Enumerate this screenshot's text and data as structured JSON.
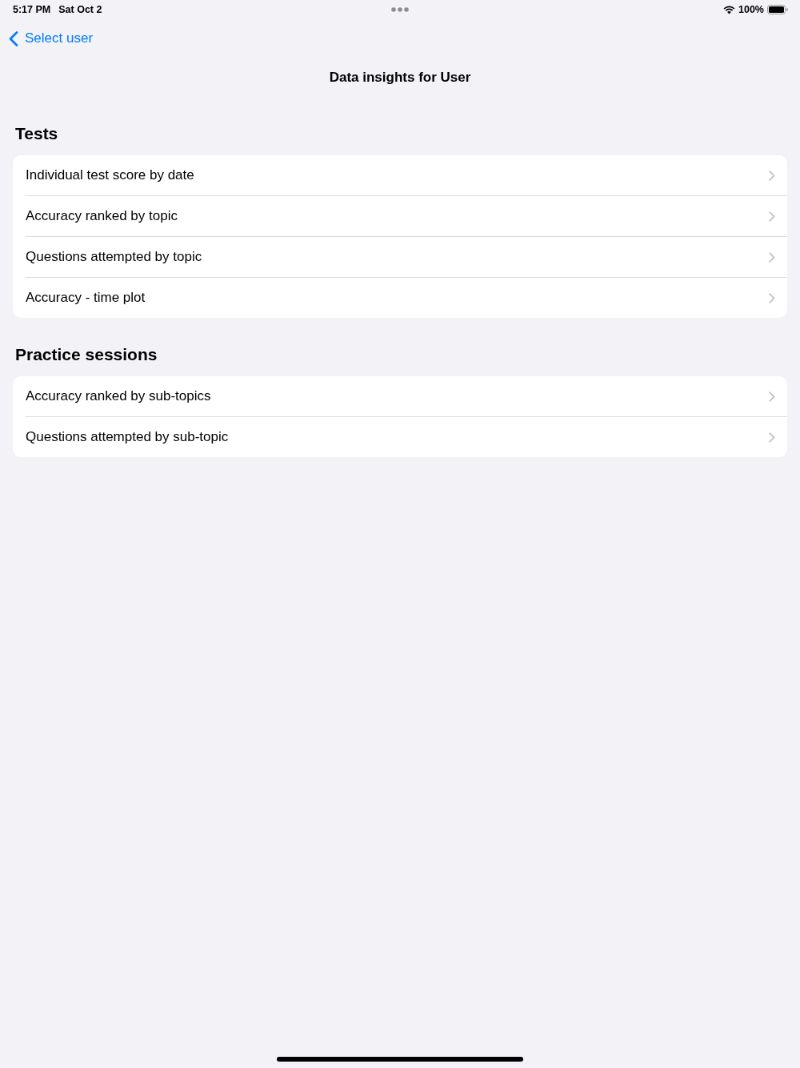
{
  "status_bar": {
    "time": "5:17 PM",
    "date": "Sat Oct 2",
    "battery": "100%"
  },
  "nav": {
    "back": "Select user",
    "title": "Data insights for User"
  },
  "sections": [
    {
      "header": "Tests",
      "items": [
        "Individual test score by date",
        "Accuracy ranked by topic",
        "Questions attempted by topic",
        "Accuracy - time plot"
      ]
    },
    {
      "header": "Practice sessions",
      "items": [
        "Accuracy ranked by sub-topics",
        "Questions attempted by sub-topic"
      ]
    }
  ]
}
